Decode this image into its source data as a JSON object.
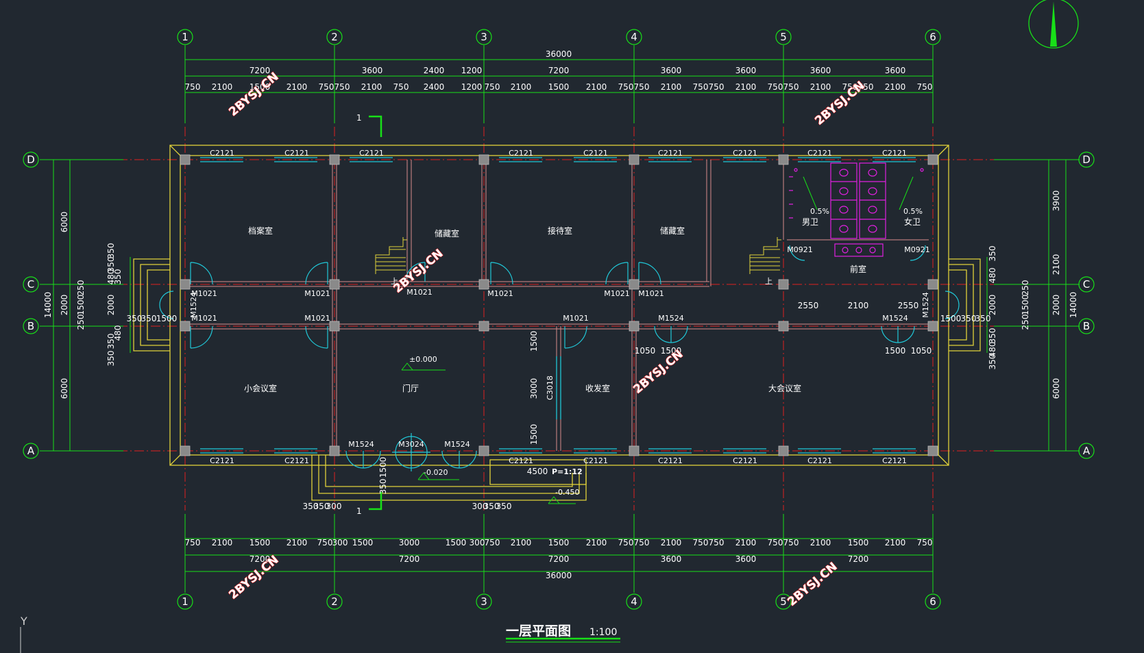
{
  "title": "一层平面图",
  "scale": "1:100",
  "colors": {
    "background": "#212830",
    "dim_line": "#18e018",
    "wall": "#e0d23a",
    "axis": "#e01f1f",
    "window": "#20c8d8",
    "door": "#20c8d8",
    "toilet": "#e020e0",
    "column": "#8a8a8a",
    "text": "#ffffff",
    "watermark_fill": "#ffffff",
    "watermark_stroke": "#ff2a2a"
  },
  "axes": {
    "vertical": [
      "1",
      "2",
      "3",
      "4",
      "5",
      "6"
    ],
    "horizontal": [
      "D",
      "C",
      "B",
      "A"
    ]
  },
  "dims": {
    "top_total": "36000",
    "top_row2": [
      "7200",
      "3600",
      "2400",
      "1200",
      "7200",
      "3600",
      "3600",
      "3600",
      "3600"
    ],
    "top_row3": [
      "750",
      "2100",
      "1500",
      "2100",
      "750",
      "750",
      "2100",
      "750",
      "2400",
      "1200",
      "750",
      "2100",
      "1500",
      "2100",
      "750",
      "750",
      "2100",
      "750",
      "750",
      "2100",
      "750",
      "750",
      "2100",
      "750",
      "750",
      "2100",
      "750"
    ],
    "bottom_total": "36000",
    "bottom_row2": [
      "7200",
      "7200",
      "7200",
      "3600",
      "3600",
      "7200"
    ],
    "bottom_row3": [
      "750",
      "2100",
      "1500",
      "2100",
      "750",
      "300",
      "1500",
      "3000",
      "1500",
      "300",
      "750",
      "2100",
      "1500",
      "2100",
      "750",
      "750",
      "2100",
      "750",
      "750",
      "2100",
      "750",
      "750",
      "2100",
      "1500",
      "2100",
      "750"
    ],
    "left_total": "14000",
    "left_bays": [
      "6000",
      "2000",
      "6000"
    ],
    "left_detail": [
      "350",
      "350",
      "480",
      "250",
      "1500",
      "250",
      "2000",
      "350",
      "350",
      "480",
      "350"
    ],
    "right_total": "14000",
    "right_bays": [
      "3900",
      "2100",
      "2000",
      "6000"
    ],
    "right_detail": [
      "350",
      "480",
      "250",
      "1500",
      "250",
      "2000",
      "350",
      "480",
      "350"
    ],
    "entry": [
      "350",
      "350",
      "1500",
      "1500",
      "350",
      "350"
    ],
    "stairs": [
      "350",
      "350",
      "300",
      "300",
      "350",
      "350",
      "350",
      "1500"
    ],
    "interior": [
      "2550",
      "2100",
      "2550",
      "1050",
      "1500",
      "1500",
      "1050",
      "1500",
      "3000",
      "1500",
      "4500"
    ]
  },
  "rooms": {
    "archive": "档案室",
    "storage_1": "储藏室",
    "reception": "接待室",
    "storage_2": "储藏室",
    "men_wc": "男卫",
    "women_wc": "女卫",
    "anteroom": "前室",
    "small_meeting": "小会议室",
    "hall": "门厅",
    "mail_room": "收发室",
    "large_meeting": "大会议室"
  },
  "windows": [
    "C2121",
    "C3018"
  ],
  "doors": [
    "M1021",
    "M1524",
    "M0921",
    "M3024"
  ],
  "levels": {
    "floor": "±0.000",
    "entry": "-0.020",
    "ground": "-0.450",
    "ramp": "P=1:12",
    "slope": "0.5%"
  },
  "section_mark": "1",
  "stair_label": "上",
  "watermark": "2BYSJ.CN",
  "ucs_label": "Y"
}
